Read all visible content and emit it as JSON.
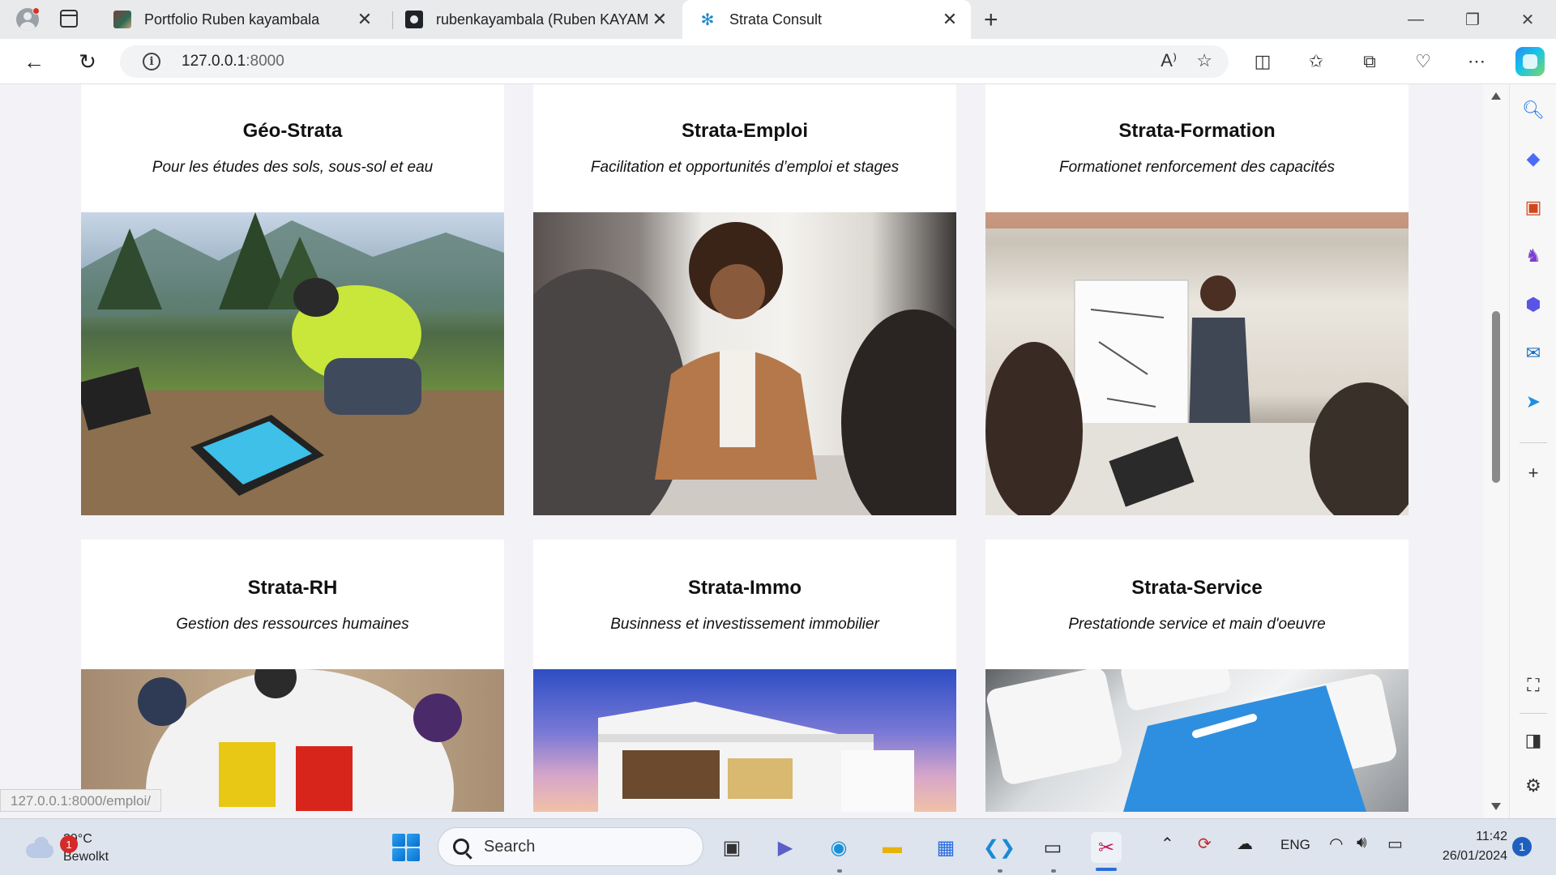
{
  "browser": {
    "tabs": [
      {
        "title": "Portfolio Ruben kayambala",
        "favicon": "portfolio-icon",
        "active": false
      },
      {
        "title": "rubenkayambala (Ruben KAYAMB",
        "favicon": "github-icon",
        "active": false
      },
      {
        "title": "Strata Consult",
        "favicon": "strata-icon",
        "active": true
      }
    ],
    "address": {
      "host": "127.0.0.1",
      "port": ":8000"
    },
    "status_url": "127.0.0.1:8000/emploi/"
  },
  "services": [
    {
      "title": "Géo-Strata",
      "subtitle": "Pour les études des sols, sous-sol et eau",
      "image": "geologist-tablet-photo"
    },
    {
      "title": "Strata-Emploi",
      "subtitle": "Facilitation et opportunités d’emploi et stages",
      "image": "job-interview-photo"
    },
    {
      "title": "Strata-Formation",
      "subtitle": "Formationet renforcement des capacités",
      "image": "training-whiteboard-photo"
    },
    {
      "title": "Strata-RH",
      "subtitle": "Gestion des ressources humaines",
      "image": "team-puzzle-photo"
    },
    {
      "title": "Strata-Immo",
      "subtitle": "Businness et investissement immobilier",
      "image": "modern-house-photo"
    },
    {
      "title": "Strata-Service",
      "subtitle": "Prestationde service et main d'oeuvre",
      "image": "service-keyboard-photo"
    }
  ],
  "taskbar": {
    "weather": {
      "temp": "29°C",
      "condition": "Bewolkt",
      "badge": "1"
    },
    "search_label": "Search",
    "language": "ENG",
    "time": "11:42",
    "date": "26/01/2024",
    "notifications": "1"
  },
  "colors": {
    "accent": "#2b6ed6",
    "page_bg": "#f3f3f7",
    "card_bg": "#ffffff"
  }
}
